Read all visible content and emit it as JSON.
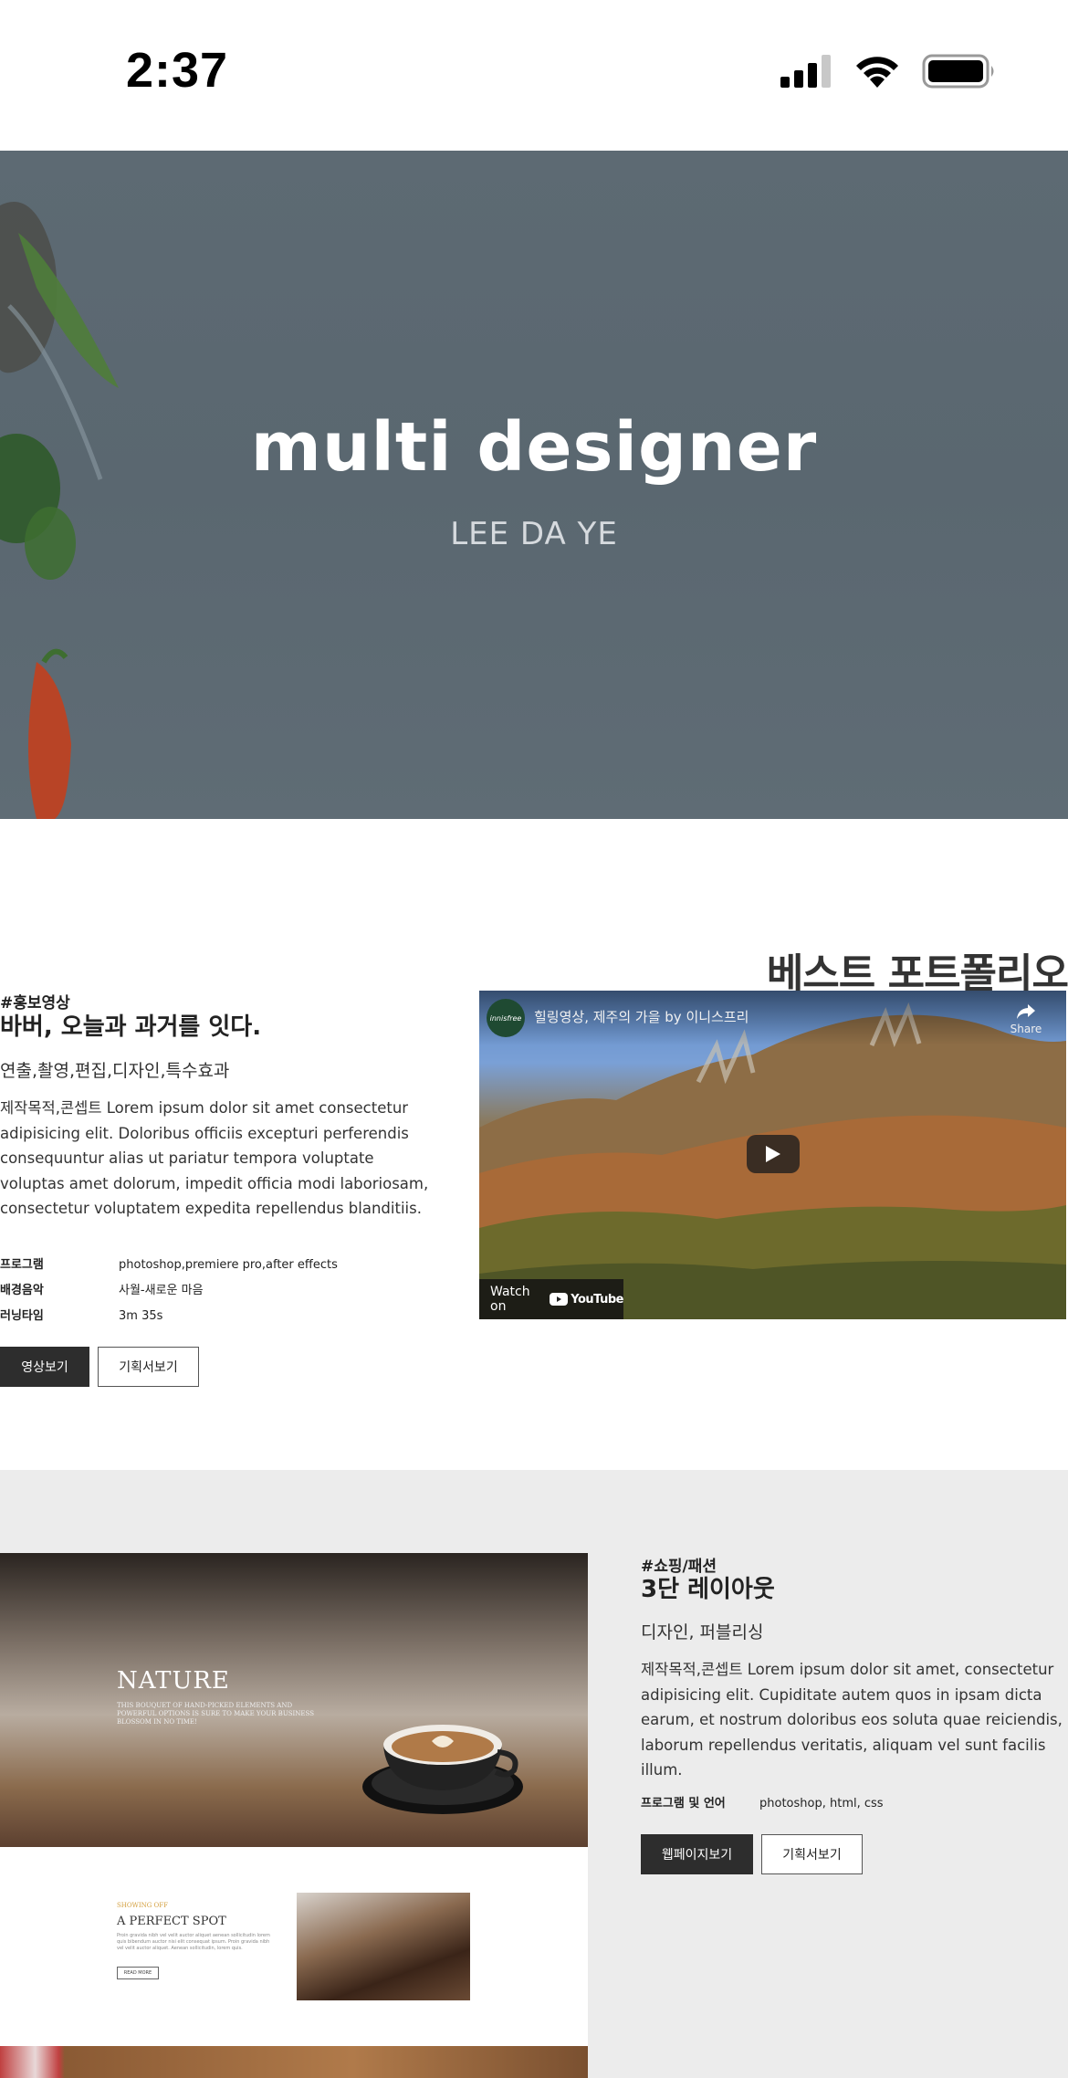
{
  "status": {
    "time": "2:37"
  },
  "hero": {
    "title": "multi designer",
    "subtitle": "LEE DA YE"
  },
  "section_title": "베스트 포트폴리오",
  "portfolio1": {
    "tag": "#홍보영상",
    "title": "바버, 오늘과 과거를 잇다.",
    "subtitle": "연출,촬영,편집,디자인,특수효과",
    "description": "제작목적,콘셉트 Lorem ipsum dolor sit amet consectetur adipisicing elit. Doloribus officiis excepturi perferendis consequuntur alias ut pariatur tempora voluptate voluptas amet dolorum, impedit officia modi laboriosam, consectetur voluptatem expedita repellendus blanditiis.",
    "info": [
      {
        "label": "프로그램",
        "value": "photoshop,premiere pro,after effects"
      },
      {
        "label": "배경음악",
        "value": "사월-새로운 마음"
      },
      {
        "label": "러닝타임",
        "value": "3m 35s"
      }
    ],
    "buttons": {
      "primary": "영상보기",
      "secondary": "기획서보기"
    },
    "video": {
      "channel_logo": "innisfree",
      "title": "힐링영상, 제주의 가을 by 이니스프리",
      "share_label": "Share",
      "watch_on": "Watch on",
      "youtube": "YouTube"
    }
  },
  "portfolio2": {
    "tag": "#쇼핑/패션",
    "title": "3단 레이아웃",
    "subtitle": "디자인, 퍼블리싱",
    "description": "제작목적,콘셉트 Lorem ipsum dolor sit amet, consectetur adipisicing elit. Cupiditate autem quos in ipsam dicta earum, et nostrum doloribus eos soluta quae reiciendis, laborum repellendus veritatis, aliquam vel sunt facilis illum.",
    "info": [
      {
        "label": "프로그램 및 언어",
        "value": "photoshop, html, css"
      }
    ],
    "buttons": {
      "primary": "웹페이지보기",
      "secondary": "기획서보기"
    },
    "screenshot": {
      "hero_title": "NATURE",
      "hero_text": "THIS BOUQUET OF HAND-PICKED ELEMENTS AND POWERFUL OPTIONS IS SURE TO MAKE YOUR BUSINESS BLOSSOM IN NO TIME!",
      "kicker": "SHOWING OFF",
      "section_title": "A PERFECT SPOT",
      "section_text": "Proin gravida nibh vel velit auctor aliquet aenean sollicitudin lorem quis bibendum auctor nisi elit consequat ipsum. Proin gravida nibh vel velit auctor aliquet. Aenean sollicitudin, lorem quis.",
      "read_more": "READ MORE"
    }
  },
  "colors": {
    "button_dark": "#2d2d2d",
    "section_bg": "#ececec",
    "hero_overlay": "#5d6a73"
  }
}
